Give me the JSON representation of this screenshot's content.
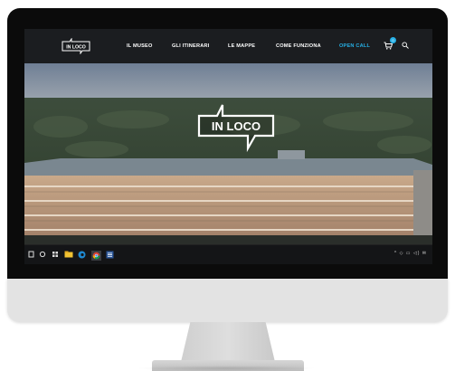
{
  "site": {
    "logo_text": "IN LOCO",
    "nav": [
      {
        "label": "IL MUSEO"
      },
      {
        "label": "GLI ITINERARI"
      },
      {
        "label": "LE MAPPE"
      },
      {
        "label": "COME FUNZIONA"
      },
      {
        "label": "OPEN CALL"
      }
    ],
    "accent_color": "#26b0e6",
    "cart_count": "0",
    "icons": [
      "cart-icon",
      "search-icon"
    ]
  },
  "hero": {
    "logo_text": "IN LOCO"
  },
  "taskbar": {
    "icons": [
      "windows-icon",
      "search-icon",
      "task-view-icon",
      "file-explorer-icon",
      "edge-icon",
      "chrome-icon",
      "word-icon"
    ],
    "tray_text": "^ ◇ ▭ ◁) ✉"
  }
}
